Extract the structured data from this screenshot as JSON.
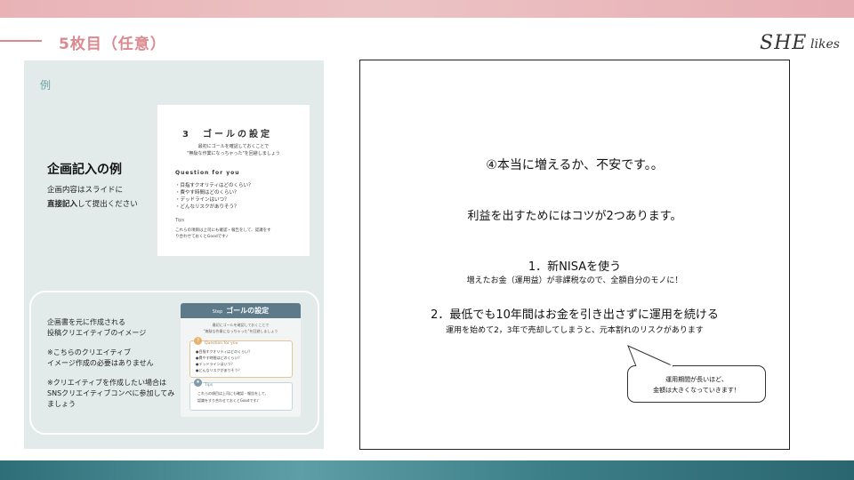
{
  "header": {
    "title": "5枚目（任意）",
    "logo_script": "SHE",
    "logo_word": "likes"
  },
  "left_panel": {
    "example_label": "例",
    "heading": "企画記入の例",
    "desc_line1": "企画内容はスライドに",
    "desc_line2_bold": "直接記入",
    "desc_line2_rest": "して提出ください",
    "goal_card": {
      "title": "3　ゴールの設定",
      "sub1": "最初にゴールを確認しておくことで",
      "sub2": "\"無駄な作業になっちゃった\"を回避しましょう",
      "question_label": "Question for you",
      "items": [
        "・目指すクオリティはどのくらい？",
        "・費やす時間はどのくらい？",
        "・デッドラインはいつ？",
        "・どんなリスクがありそう？"
      ],
      "tips_label": "Tips",
      "tip1": "これらの項目は上司にも確認・報告をして、認識をす",
      "tip2": "り合わせておくとGoodです♪"
    },
    "bottom_box": {
      "line1": "企画書を元に作成される",
      "line2": "投稿クリエイティブのイメージ",
      "line3": "※こちらのクリエイティブ",
      "line4": "イメージ作成の必要はありません",
      "line5": "※クリエイティブを作成したい場合は",
      "line6": "SNSクリエイティブコンペに参加してみ",
      "line7": "ましょう"
    },
    "mock_card": {
      "header": "ゴールの設定",
      "header_small": "Step",
      "sub1": "最初にゴールを確認しておくことで",
      "sub2": "\"無駄な作業になっちゃった\"を回避しましょう",
      "q_num": "?",
      "q_label": "Question for you",
      "q_items": [
        "●目指すクオリティはどのくらい？",
        "●費やす時間はどのくらい？",
        "●デッドラインはいつ？",
        "●どんなリスクがありそう？"
      ],
      "t_num": "★",
      "t_label": "Tips",
      "t1": "これらの項目は上司にも確認・報告をして、",
      "t2": "認識をすり合わせておくとGoodです♪"
    }
  },
  "right_panel": {
    "heading": "④本当に増えるか、不安です。。",
    "subheading": "利益を出すためにはコツが2つあります。",
    "point1": "1．新NISAを使う",
    "point1_sub": "増えたお金（運用益）が非課税なので、全額自分のモノに！",
    "point2": "2．最低でも10年間はお金を引き出さずに運用を続ける",
    "point2_sub": "運用を始めて2，3年で売却してしまうと、元本割れのリスクがあります",
    "bubble_line1": "運用期間が長いほど、",
    "bubble_line2": "金額は大きくなっていきます！"
  }
}
